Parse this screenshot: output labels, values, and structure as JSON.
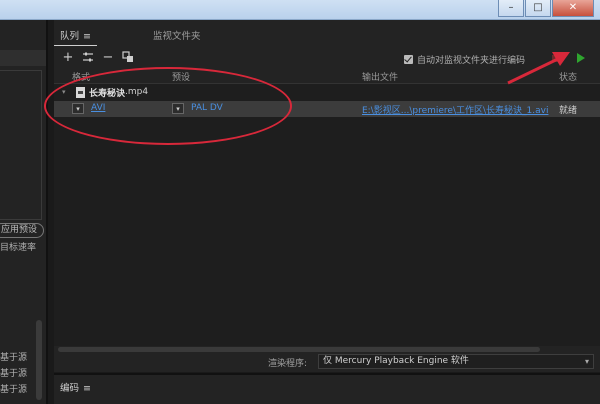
{
  "queue": {
    "tab_queue": "队列",
    "tab_watch": "监视文件夹",
    "auto_encode_label": "自动对监视文件夹进行编码",
    "columns": {
      "format": "格式",
      "preset": "预设",
      "output": "输出文件",
      "status": "状态"
    },
    "group": {
      "name": "长寿秘诀",
      "ext": ".mp4"
    },
    "item": {
      "format": "AVI",
      "preset": "PAL DV",
      "output": "E:\\影视区...\\premiere\\工作区\\长寿秘诀_1.avi",
      "status": "就绪"
    },
    "renderer_label": "渲染程序:",
    "renderer_value": "仅 Mercury Playback Engine 软件"
  },
  "encode": {
    "tab": "编码"
  },
  "left": {
    "preset_btn": "应用预设",
    "target_rate": "目标速率",
    "src_lines": [
      "基于源",
      "基于源",
      "基于源"
    ]
  },
  "colors": {
    "annotation": "#d8283a",
    "play": "#2fa52f",
    "stop": "#6b2a2a",
    "link": "#4a8fe0"
  }
}
